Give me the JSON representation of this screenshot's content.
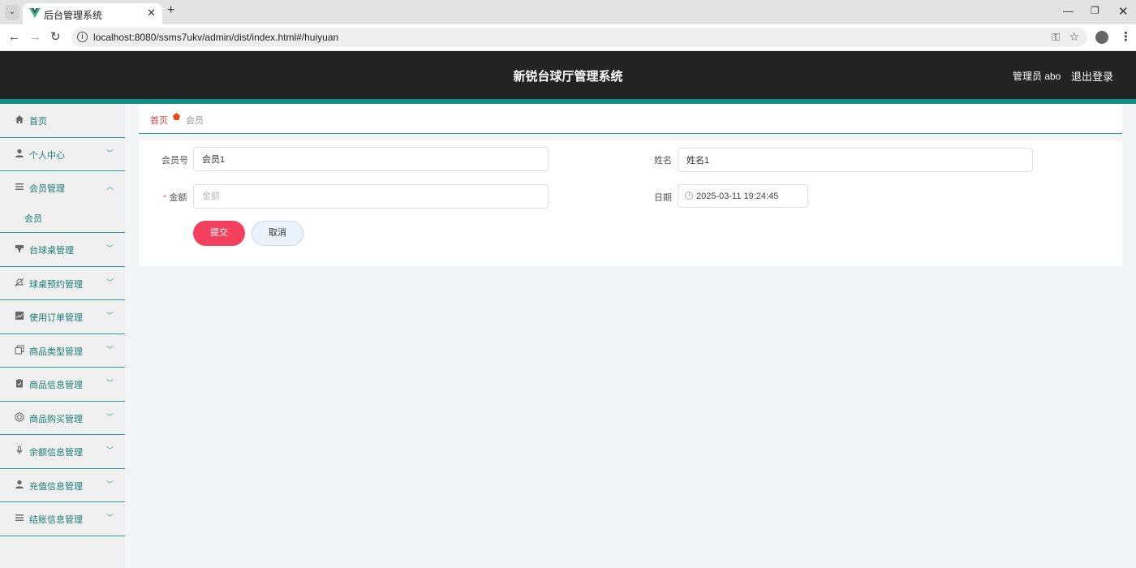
{
  "browser": {
    "tab_title": "后台管理系统",
    "url": "localhost:8080/ssms7ukv/admin/dist/index.html#/huiyuan"
  },
  "header": {
    "title": "新锐台球厅管理系统",
    "admin_label": "管理员 abo",
    "logout_label": "退出登录"
  },
  "sidebar": {
    "items": [
      {
        "label": "首页",
        "icon": "home-icon",
        "expandable": false
      },
      {
        "label": "个人中心",
        "icon": "user-icon",
        "expandable": true
      },
      {
        "label": "会员管理",
        "icon": "list-icon",
        "expandable": true,
        "expanded": true,
        "children": [
          "会员"
        ]
      },
      {
        "label": "台球桌管理",
        "icon": "table-icon",
        "expandable": true
      },
      {
        "label": "球桌预约管理",
        "icon": "bell-off-icon",
        "expandable": true
      },
      {
        "label": "使用订单管理",
        "icon": "chart-icon",
        "expandable": true
      },
      {
        "label": "商品类型管理",
        "icon": "copy-icon",
        "expandable": true
      },
      {
        "label": "商品信息管理",
        "icon": "clipboard-icon",
        "expandable": true
      },
      {
        "label": "商品购买管理",
        "icon": "basketball-icon",
        "expandable": true
      },
      {
        "label": "余额信息管理",
        "icon": "microphone-icon",
        "expandable": true
      },
      {
        "label": "充值信息管理",
        "icon": "user-icon",
        "expandable": true
      },
      {
        "label": "结账信息管理",
        "icon": "list-icon",
        "expandable": true
      }
    ]
  },
  "breadcrumb": {
    "home": "首页",
    "current": "会员"
  },
  "form": {
    "member_no_label": "会员号",
    "member_no_value": "会员1",
    "name_label": "姓名",
    "name_value": "姓名1",
    "amount_label": "金额",
    "amount_placeholder": "金额",
    "date_label": "日期",
    "date_value": "2025-03-11 19:24:45",
    "submit_label": "提交",
    "cancel_label": "取消"
  },
  "colors": {
    "header_bg": "#232323",
    "accent": "#0f8f83",
    "submit": "#f43f5e",
    "breadcrumb_home": "#e6433a"
  }
}
